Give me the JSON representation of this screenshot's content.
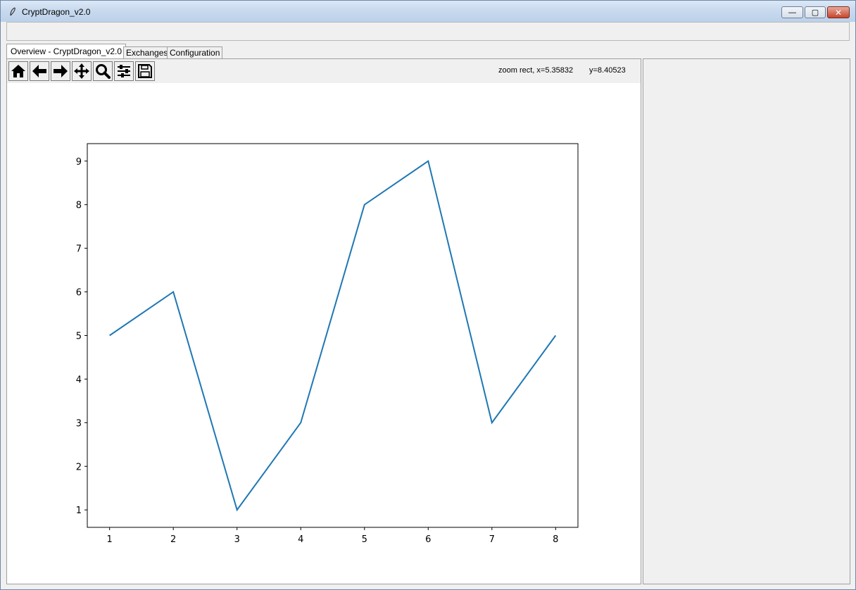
{
  "window": {
    "title": "CryptDragon_v2.0",
    "app_icon": "feather-icon",
    "controls": {
      "minimize": "minimize-icon",
      "maximize": "maximize-icon",
      "close": "close-icon"
    }
  },
  "tabs": [
    {
      "label": "Overview - CryptDragon_v2.0",
      "active": true
    },
    {
      "label": "Exchanges",
      "active": false
    },
    {
      "label": "Configuration",
      "active": false
    }
  ],
  "toolbar": {
    "buttons": [
      "home-icon",
      "back-arrow-icon",
      "forward-arrow-icon",
      "pan-icon",
      "zoom-icon",
      "configure-subplots-icon",
      "save-icon"
    ],
    "status_x": "zoom rect, x=5.35832",
    "status_y": "y=8.40523"
  },
  "chart_data": {
    "type": "line",
    "x": [
      1,
      2,
      3,
      4,
      5,
      6,
      7,
      8
    ],
    "series": [
      {
        "values": [
          5,
          6,
          1,
          3,
          8,
          9,
          3,
          5
        ],
        "color": "#1f77b4"
      }
    ],
    "xticks": [
      "1",
      "2",
      "3",
      "4",
      "5",
      "6",
      "7",
      "8"
    ],
    "yticks": [
      "1",
      "2",
      "3",
      "4",
      "5",
      "6",
      "7",
      "8",
      "9"
    ],
    "title": "",
    "xlabel": "",
    "ylabel": "",
    "xlim": [
      0.65,
      8.35
    ],
    "ylim": [
      0.6,
      9.4
    ],
    "grid": false
  }
}
